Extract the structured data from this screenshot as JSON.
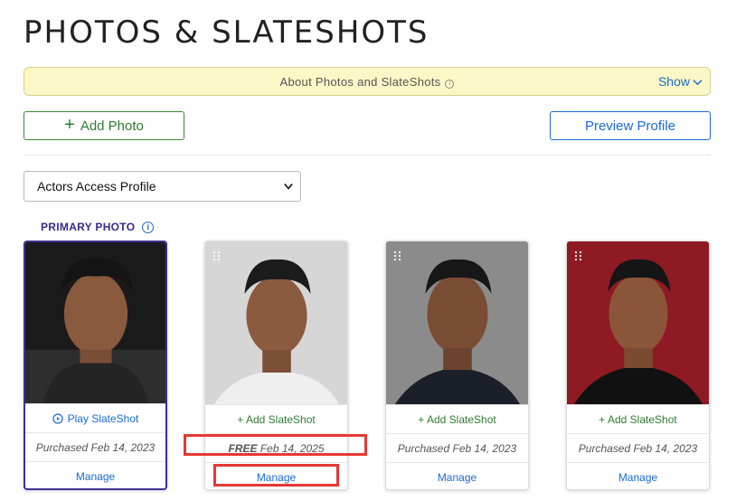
{
  "header": {
    "title": "PHOTOS & SLATESHOTS"
  },
  "banner": {
    "text": "About Photos and SlateShots",
    "info_icon": "ⓘ",
    "show_label": "Show"
  },
  "toolbar": {
    "add_photo_label": "Add Photo",
    "add_photo_plus": "+",
    "preview_label": "Preview Profile"
  },
  "profile_select": {
    "selected": "Actors Access Profile"
  },
  "primary": {
    "label": "PRIMARY PHOTO",
    "info_icon": "i"
  },
  "cards": [
    {
      "slate_label": "Play SlateShot",
      "free_label": "",
      "purchased_text": "Purchased Feb 14, 2023",
      "manage_label": "Manage",
      "bg": "#2a2a2a"
    },
    {
      "slate_label": "+ Add SlateShot",
      "free_label": "FREE",
      "purchased_text": "Feb 14, 2025",
      "manage_label": "Manage",
      "bg": "#d8d8d8"
    },
    {
      "slate_label": "+ Add SlateShot",
      "free_label": "",
      "purchased_text": "Purchased Feb 14, 2023",
      "manage_label": "Manage",
      "bg": "#8d8d8d"
    },
    {
      "slate_label": "+ Add SlateShot",
      "free_label": "",
      "purchased_text": "Purchased Feb 14, 2023",
      "manage_label": "Manage",
      "bg": "#8e1a24"
    }
  ],
  "colors": {
    "accent_blue": "#1a6bd0",
    "accent_green": "#2e7d32",
    "primary_border": "#3d2f8f",
    "highlight_red": "#e53935"
  }
}
